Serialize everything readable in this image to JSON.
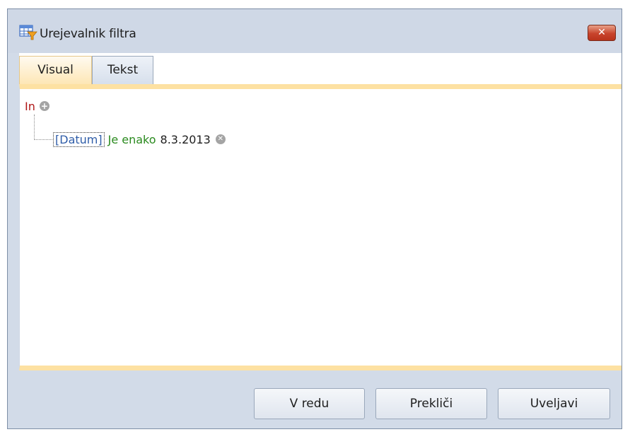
{
  "window": {
    "title": "Urejevalnik filtra",
    "close_label": "✕"
  },
  "tabs": [
    {
      "label": "Visual",
      "active": true
    },
    {
      "label": "Tekst",
      "active": false
    }
  ],
  "filter": {
    "group_operator": "In",
    "conditions": [
      {
        "field": "[Datum]",
        "operator": "Je enako",
        "value": "8.3.2013"
      }
    ]
  },
  "buttons": {
    "ok": "V redu",
    "cancel": "Prekliči",
    "apply": "Uveljavi"
  },
  "colors": {
    "group_operator": "#b01818",
    "field": "#2f5da8",
    "operator": "#2a8a1e",
    "accent": "#fde1a2",
    "close": "#c8432c"
  }
}
